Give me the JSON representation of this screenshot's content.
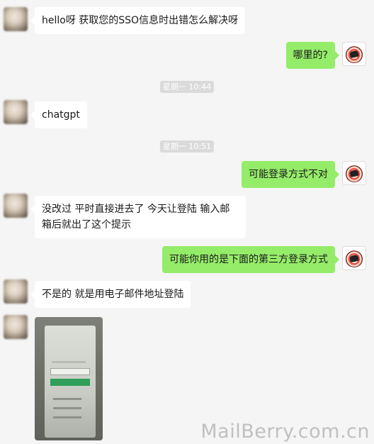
{
  "messages": {
    "m1": "hello呀 获取您的SSO信息时出错怎么解决呀",
    "m2": "哪里的?",
    "t1": "星期一 10:44",
    "m3": "chatgpt",
    "t2": "星期一 10:51",
    "m4": "可能登录方式不对",
    "m5": "没改过 平时直接进去了 今天让登陆 输入邮箱后就出了这个提示",
    "m6": "可能你用的是下面的第三方登录方式",
    "m7": "不是的 就是用电子邮件地址登陆"
  },
  "watermark": "MailBerry.com.cn",
  "colors": {
    "background": "#f5f5f5",
    "incoming_bubble": "#ffffff",
    "outgoing_bubble": "#95ec69",
    "time_badge": "#dadada"
  }
}
